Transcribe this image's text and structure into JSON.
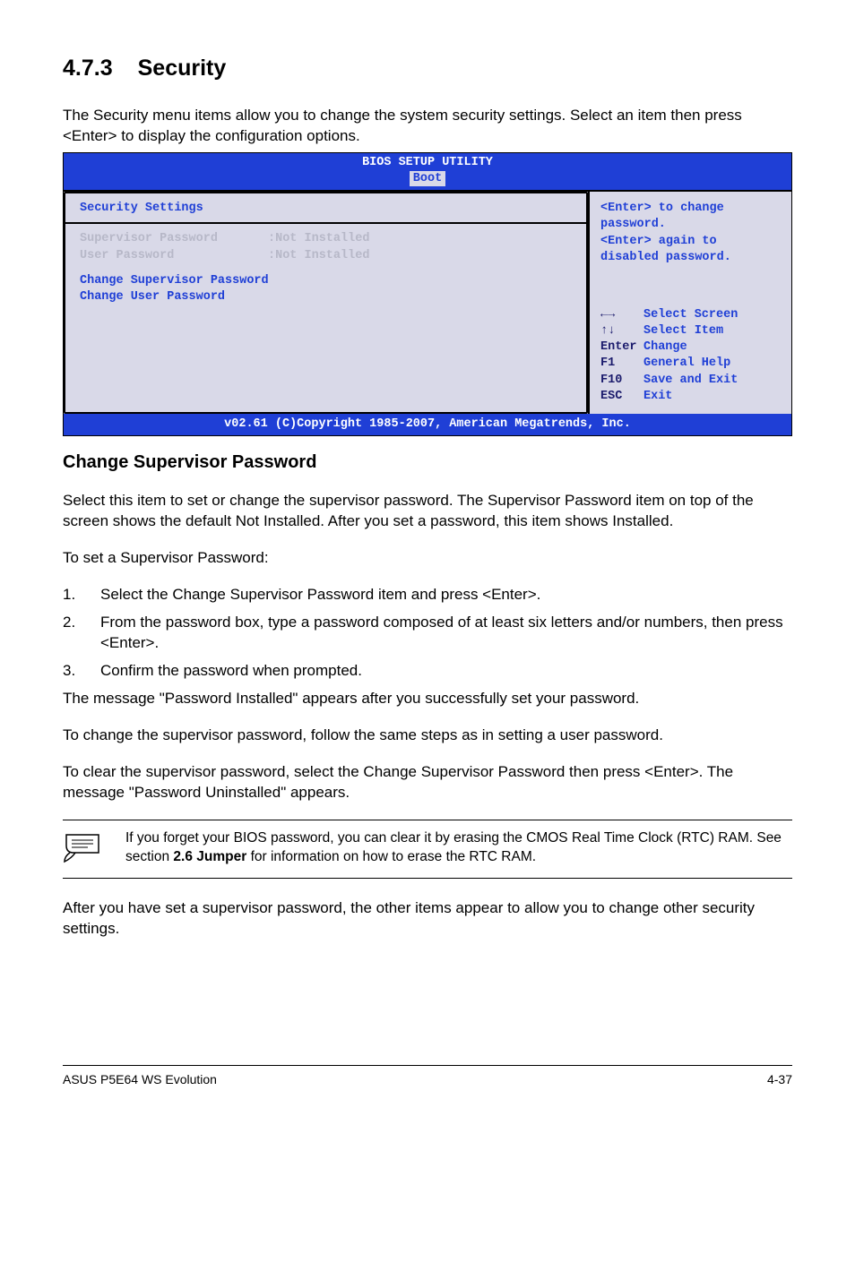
{
  "heading": {
    "number": "4.7.3",
    "title": "Security"
  },
  "intro": "The Security menu items allow you to change the system security settings. Select an item then press <Enter> to display the configuration options.",
  "bios": {
    "title": "BIOS SETUP UTILITY",
    "selected_tab": "Boot",
    "panel_title": "Security Settings",
    "rows": [
      {
        "label": "Supervisor Password",
        "value": ":Not Installed"
      },
      {
        "label": "User Password",
        "value": ":Not Installed"
      }
    ],
    "active_items": [
      "Change Supervisor Password",
      "Change User Password"
    ],
    "help": [
      "<Enter> to change password.",
      "<Enter> again to disabled password."
    ],
    "keys": [
      {
        "k": "←→",
        "d": "Select Screen"
      },
      {
        "k": "↑↓",
        "d": "Select Item"
      },
      {
        "k": "Enter",
        "d": "Change"
      },
      {
        "k": "F1",
        "d": "General Help"
      },
      {
        "k": "F10",
        "d": "Save and Exit"
      },
      {
        "k": "ESC",
        "d": "Exit"
      }
    ],
    "copyright": "v02.61 (C)Copyright 1985-2007, American Megatrends, Inc."
  },
  "sub_heading": "Change Supervisor Password",
  "p1": "Select this item to set or change the supervisor password. The Supervisor Password item on top of the screen shows the default Not Installed. After you set a password, this item shows Installed.",
  "p2": "To set a Supervisor Password:",
  "steps": [
    {
      "n": "1.",
      "t": "Select the Change Supervisor Password item and press <Enter>."
    },
    {
      "n": "2.",
      "t": "From the password box, type a password composed of at least six letters and/or numbers, then press <Enter>."
    },
    {
      "n": "3.",
      "t": "Confirm the password when prompted."
    }
  ],
  "p3": "The message \"Password Installed\" appears after you successfully set your password.",
  "p4": "To change the supervisor password, follow the same steps as in setting a user password.",
  "p5": "To clear the supervisor password, select the Change Supervisor Password then press <Enter>. The message \"Password Uninstalled\" appears.",
  "note": {
    "t1": "If you forget your BIOS password, you can clear it by erasing the CMOS Real Time Clock (RTC) RAM. See section ",
    "bold": "2.6 Jumper",
    "t2": " for information on how to erase the RTC RAM."
  },
  "p6": "After you have set a supervisor password, the other items appear to allow you to change other security settings.",
  "footer": {
    "left": "ASUS P5E64 WS Evolution",
    "right": "4-37"
  }
}
